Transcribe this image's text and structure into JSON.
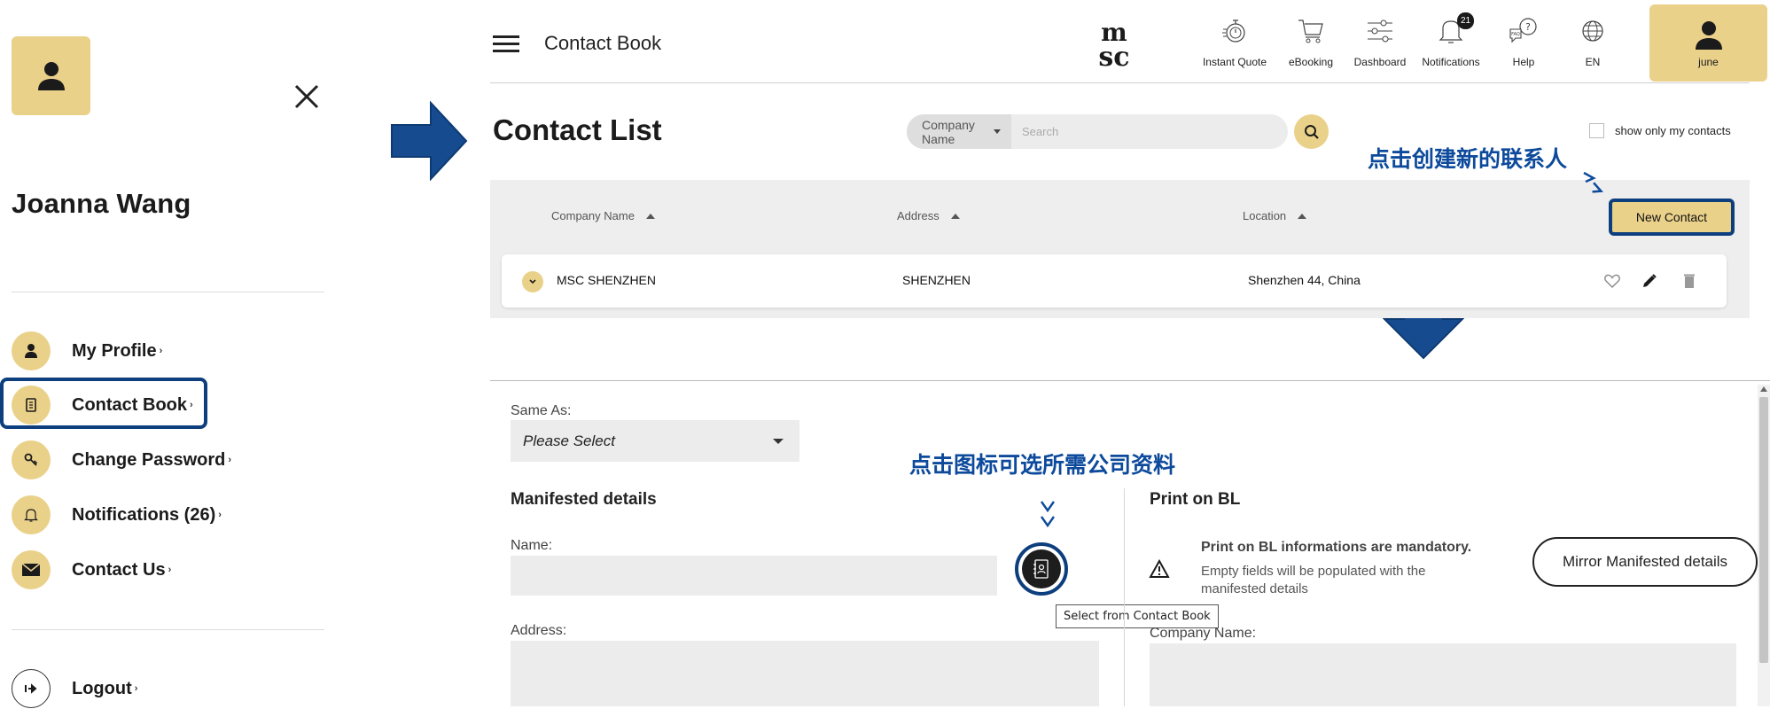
{
  "colors": {
    "accent": "#ead18a",
    "highlight": "#0d3f7e",
    "annotation": "#0d4a9c",
    "panel": "#eeeeee"
  },
  "left_panel": {
    "user_name": "Joanna Wang",
    "menu": [
      {
        "label": "My Profile",
        "icon": "user-icon"
      },
      {
        "label": "Contact Book",
        "icon": "contact-book-icon"
      },
      {
        "label": "Change Password",
        "icon": "key-icon"
      },
      {
        "label": "Notifications (26)",
        "icon": "bell-icon"
      },
      {
        "label": "Contact Us",
        "icon": "envelope-icon"
      }
    ],
    "logout": {
      "label": "Logout",
      "icon": "logout-icon"
    },
    "chevron": "›"
  },
  "header": {
    "title": "Contact Book",
    "logo_text": "msc",
    "nav": [
      {
        "label": "Instant Quote",
        "icon": "stopwatch-icon"
      },
      {
        "label": "eBooking",
        "icon": "cart-icon"
      },
      {
        "label": "Dashboard",
        "icon": "sliders-icon"
      },
      {
        "label": "Notifications",
        "icon": "bell-icon",
        "badge": "21"
      },
      {
        "label": "Help",
        "icon": "help-icon"
      },
      {
        "label": "EN",
        "icon": "globe-icon"
      }
    ],
    "user": {
      "label": "june",
      "icon": "user-icon"
    }
  },
  "contact_list": {
    "title": "Contact List",
    "search": {
      "field": "Company Name",
      "placeholder": "Search"
    },
    "show_only_mine": "show only my contacts",
    "annotation": "点击创建新的联系人",
    "columns": [
      "Company Name",
      "Address",
      "Location"
    ],
    "new_contact": "New Contact",
    "rows": [
      {
        "company": "MSC SHENZHEN",
        "address": "SHENZHEN",
        "location": "Shenzhen 44, China"
      }
    ]
  },
  "form": {
    "same_as_label": "Same As:",
    "same_as_value": "Please Select",
    "annotation": "点击图标可选所需公司资料",
    "manifested_title": "Manifested details",
    "name_label": "Name:",
    "address_label": "Address:",
    "tooltip": "Select from Contact Book",
    "print_title": "Print on BL",
    "warning_title": "Print on BL informations are mandatory.",
    "warning_text": "Empty fields will be populated with the manifested details",
    "mirror_button": "Mirror Manifested details",
    "company_name_label": "Company Name:"
  }
}
